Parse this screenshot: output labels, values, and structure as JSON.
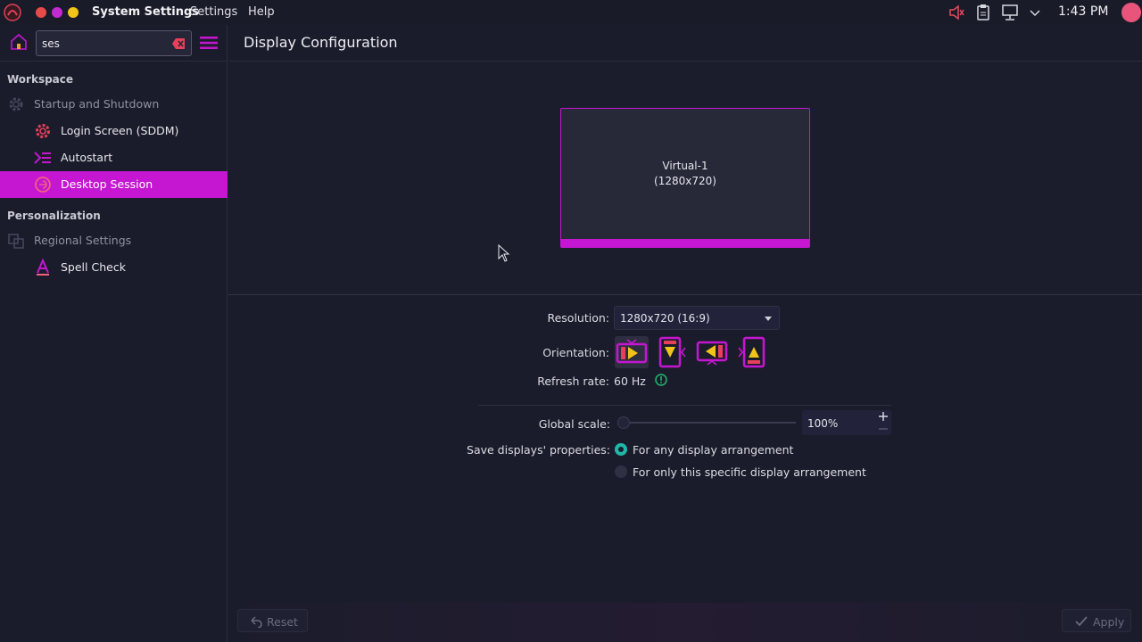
{
  "topbar": {
    "app_title": "System Settings",
    "menu": [
      "Settings",
      "Help"
    ],
    "clock": "1:43 PM",
    "tray_icons": [
      "volume-muted-icon",
      "clipboard-icon",
      "network-icon",
      "chevron-down-icon"
    ]
  },
  "sidebar": {
    "search": {
      "value": "ses",
      "placeholder": ""
    },
    "sections": [
      {
        "label": "Workspace",
        "category": "Startup and Shutdown",
        "items": [
          {
            "label": "Login Screen (SDDM)",
            "icon": "gear-icon"
          },
          {
            "label": "Autostart",
            "icon": "autostart-icon"
          },
          {
            "label": "Desktop Session",
            "icon": "session-icon",
            "active": true
          }
        ]
      },
      {
        "label": "Personalization",
        "category": "Regional Settings",
        "items": [
          {
            "label": "Spell Check",
            "icon": "spellcheck-icon"
          }
        ]
      }
    ]
  },
  "main": {
    "title": "Display Configuration",
    "monitor": {
      "name": "Virtual-1",
      "resolution": "(1280x720)"
    },
    "resolution": {
      "label": "Resolution:",
      "value": "1280x720 (16:9)"
    },
    "orientation": {
      "label": "Orientation:",
      "options": [
        "landscape-icon",
        "portrait-icon",
        "landscape-flipped-icon",
        "portrait-flipped-icon"
      ],
      "selected": 0
    },
    "refresh": {
      "label": "Refresh rate:",
      "value": "60 Hz"
    },
    "scale": {
      "label": "Global scale:",
      "value": "100%",
      "level": 0
    },
    "save": {
      "label": "Save displays' properties:",
      "options": [
        "For any display arrangement",
        "For only this specific display arrangement"
      ],
      "selected": 0
    },
    "footer": {
      "reset": "Reset",
      "apply": "Apply"
    }
  },
  "colors": {
    "accent": "#c516d1",
    "background": "#1b1c2b",
    "radio_on": "#1fb8a8"
  }
}
